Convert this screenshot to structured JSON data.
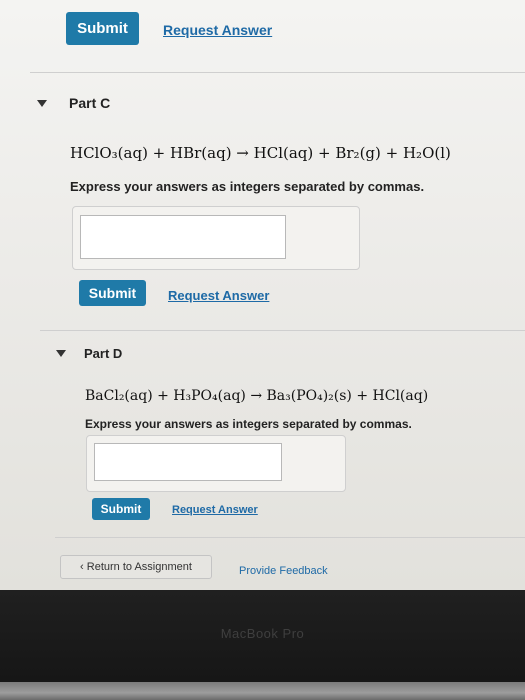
{
  "top_actions": {
    "submit_label": "Submit",
    "request_answer_label": "Request Answer"
  },
  "part_c": {
    "title": "Part C",
    "equation": "HClO₃(aq) + HBr(aq) → HCl(aq) + Br₂(g) + H₂O(l)",
    "instructions": "Express your answers as integers separated by commas.",
    "answer_value": "",
    "submit_label": "Submit",
    "request_answer_label": "Request Answer"
  },
  "part_d": {
    "title": "Part D",
    "equation": "BaCl₂(aq) + H₃PO₄(aq) → Ba₃(PO₄)₂(s) + HCl(aq)",
    "instructions": "Express your answers as integers separated by commas.",
    "answer_value": "",
    "submit_label": "Submit",
    "request_answer_label": "Request Answer"
  },
  "footer": {
    "return_label": "‹ Return to Assignment",
    "feedback_label": "Provide Feedback"
  },
  "device": {
    "label": "MacBook Pro"
  },
  "colors": {
    "accent": "#1f7aa8",
    "link": "#1e6aa6"
  }
}
